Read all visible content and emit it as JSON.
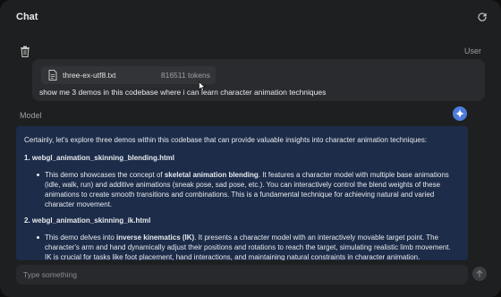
{
  "header": {
    "title": "Chat"
  },
  "user": {
    "label": "User",
    "file": {
      "name": "three-ex-utf8.txt",
      "tokens": "816511 tokens"
    },
    "text": "show me 3 demos in this codebase where i can learn character animation techniques"
  },
  "model": {
    "label": "Model",
    "intro": "Certainly, let's explore three demos within this codebase that can provide valuable insights into character animation techniques:",
    "items": [
      {
        "heading": "1. webgl_animation_skinning_blending.html",
        "lines": [
          {
            "pre": "This demo showcases the concept of ",
            "bold": "skeletal animation blending",
            "post": ". It features a character model with multiple base animations"
          },
          {
            "pre": "(idle, walk, run) and additive animations (sneak pose, sad pose, etc.). You can interactively control the blend weights of these",
            "bold": "",
            "post": ""
          },
          {
            "pre": "animations to create smooth transitions and combinations. This is a fundamental technique for achieving natural and varied",
            "bold": "",
            "post": ""
          },
          {
            "pre": "character movement.",
            "bold": "",
            "post": ""
          }
        ]
      },
      {
        "heading": "2. webgl_animation_skinning_ik.html",
        "lines": [
          {
            "pre": "This demo delves into ",
            "bold": "inverse kinematics (IK)",
            "post": ". It presents a character model with an interactively movable target point. The"
          },
          {
            "pre": "character's arm and hand dynamically adjust their positions and rotations to reach the target, simulating realistic limb movement.",
            "bold": "",
            "post": ""
          },
          {
            "pre": "IK is crucial for tasks like foot placement, hand interactions, and maintaining natural constraints in character animation.",
            "bold": "",
            "post": ""
          }
        ]
      }
    ]
  },
  "input": {
    "placeholder": "Type something"
  }
}
